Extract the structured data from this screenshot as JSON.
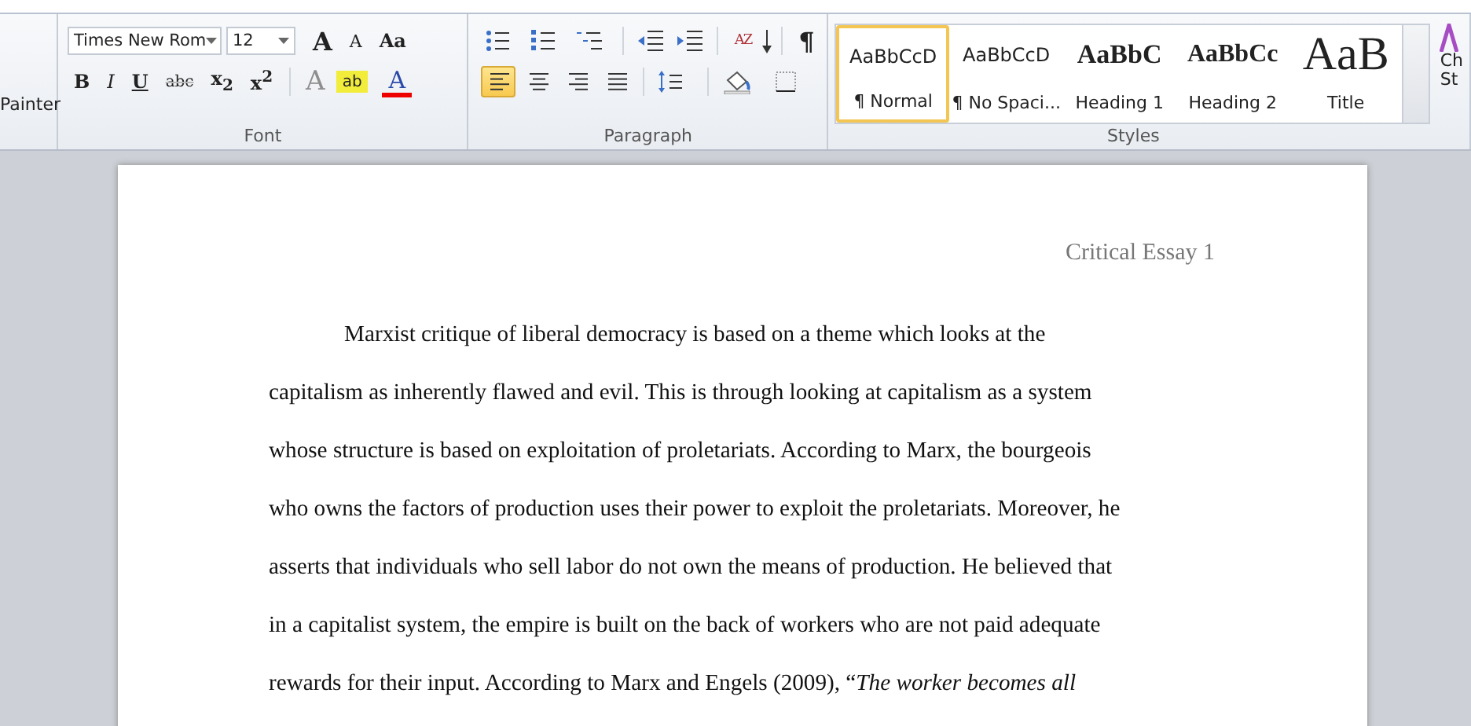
{
  "clipboard": {
    "label": "Painter"
  },
  "font_group": {
    "label": "Font",
    "font_name": "Times New Rom",
    "font_size": "12",
    "size_buttons": [
      {
        "label": "A",
        "kind": "grow"
      },
      {
        "label": "A",
        "kind": "shrink"
      },
      {
        "label": "Aa",
        "kind": "case"
      }
    ],
    "format_buttons": [
      {
        "label": "B",
        "kind": "bold"
      },
      {
        "label": "I",
        "kind": "italic"
      },
      {
        "label": "U",
        "kind": "underline"
      },
      {
        "label": "abc",
        "kind": "strike"
      },
      {
        "label": "x$_{2}$",
        "kind": "sub"
      },
      {
        "label": "x$^{2}$",
        "kind": "sup"
      }
    ],
    "color_buttons": [
      {
        "label": "A",
        "kind": "effects"
      },
      {
        "label": "ab",
        "kind": "highlight"
      },
      {
        "label": "A",
        "kind": "color"
      }
    ]
  },
  "paragraph_group": {
    "label": "Paragraph",
    "sort_label": "AZ",
    "pilcrow": "¶",
    "alignments": [
      {
        "kind": "left",
        "selected": true
      },
      {
        "kind": "center",
        "selected": false
      },
      {
        "kind": "right",
        "selected": false
      },
      {
        "kind": "justify",
        "selected": false
      }
    ]
  },
  "styles_group": {
    "label": "Styles",
    "styles": [
      {
        "preview": "AaBbCcD",
        "name": "¶ Normal",
        "kind": "normal",
        "selected": true
      },
      {
        "preview": "AaBbCcD",
        "name": "¶ No Spaci...",
        "kind": "normal",
        "selected": false
      },
      {
        "preview": "AaBbC",
        "name": "Heading 1",
        "kind": "heading1",
        "selected": false
      },
      {
        "preview": "AaBbCc",
        "name": "Heading 2",
        "kind": "heading2",
        "selected": false
      },
      {
        "preview": "AaB",
        "name": "Title",
        "kind": "title",
        "selected": false
      }
    ],
    "change_styles": [
      "Ch",
      "St"
    ]
  },
  "document": {
    "header": "Critical Essay 1",
    "lines": [
      "Marxist critique of liberal democracy is based on a theme which looks at the",
      "capitalism as inherently flawed and evil. This is through looking at capitalism as a system",
      "whose structure is based on exploitation of proletariats. According to Marx, the bourgeois",
      "who owns the factors of production uses their power to exploit the proletariats. Moreover, he",
      "asserts that individuals who sell labor do not own the means of production. He believed that",
      "in a capitalist system, the empire is built on the back of workers who are not paid adequate",
      "rewards for their input. According to Marx and Engels (2009), “*The worker becomes all*"
    ]
  }
}
